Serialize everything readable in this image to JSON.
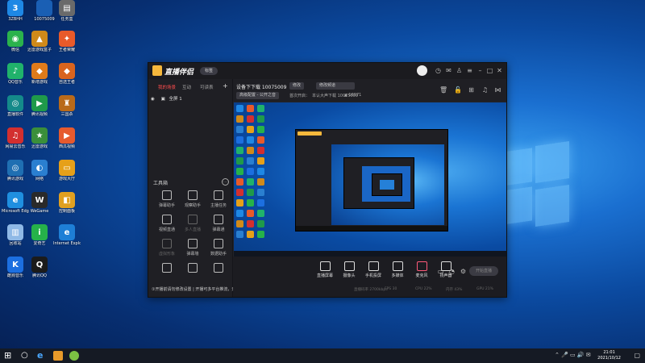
{
  "desktop": {
    "icons": [
      {
        "label": "3ZBHH",
        "color": "#1e88e5",
        "glyph": "3"
      },
      {
        "label": "10075009",
        "color": "#1a5fb4",
        "glyph": ""
      },
      {
        "label": "任务盒",
        "color": "#6a6a6a",
        "glyph": "▤"
      },
      {
        "label": "微信",
        "color": "#2bb24c",
        "glyph": "◉"
      },
      {
        "label": "迅雷游戏盒子",
        "color": "#d08a1a",
        "glyph": "▲"
      },
      {
        "label": "王者荣耀",
        "color": "#e85a2a",
        "glyph": "✦"
      },
      {
        "label": "QQ音乐",
        "color": "#20b26b",
        "glyph": "♪"
      },
      {
        "label": "新增游戏",
        "color": "#e07b1a",
        "glyph": "◆"
      },
      {
        "label": "自选王者",
        "color": "#d9641e",
        "glyph": "◆"
      },
      {
        "label": "直播软件",
        "color": "#148a8a",
        "glyph": "◎"
      },
      {
        "label": "腾讯视频",
        "color": "#1f9a4a",
        "glyph": "▶"
      },
      {
        "label": "三国杀",
        "color": "#b96a1a",
        "glyph": "♜"
      },
      {
        "label": "网易云音乐",
        "color": "#d32f2f",
        "glyph": "♫"
      },
      {
        "label": "迅雷游戏",
        "color": "#3a8f3a",
        "glyph": "★"
      },
      {
        "label": "西瓜视频",
        "color": "#e65a2e",
        "glyph": "▶"
      },
      {
        "label": "腾讯游戏",
        "color": "#1f6fb2",
        "glyph": "◎"
      },
      {
        "label": "网络",
        "color": "#2a7fd0",
        "glyph": "◐"
      },
      {
        "label": "游戏大厅",
        "color": "#e6a019",
        "glyph": "▭"
      },
      {
        "label": "Microsoft Edge",
        "color": "#1f8fe0",
        "glyph": "e"
      },
      {
        "label": "WeGame",
        "color": "#2a2a2a",
        "glyph": "W"
      },
      {
        "label": "控制面板",
        "color": "#e0a020",
        "glyph": "◧"
      },
      {
        "label": "回收站",
        "color": "#8fb9e6",
        "glyph": "▥"
      },
      {
        "label": "爱奇艺",
        "color": "#26b24a",
        "glyph": "i"
      },
      {
        "label": "Internet Explorer",
        "color": "#1e7fd6",
        "glyph": "e"
      },
      {
        "label": "酷狗音乐",
        "color": "#1c6fe0",
        "glyph": "K"
      },
      {
        "label": "腾讯QQ",
        "color": "#1b1b1b",
        "glyph": "Q"
      }
    ]
  },
  "window": {
    "app_title": "直播伴侣",
    "version_pill": "标签",
    "titlebar_icons": [
      "avatar",
      "clock-icon",
      "mail-icon",
      "shirt-icon",
      "menu-icon",
      "minimize-icon",
      "maximize-icon",
      "close-icon"
    ],
    "left_tabs": [
      "我的场景",
      "互动",
      "可读表"
    ],
    "scene_label": "全屏 1",
    "tools_title": "工具箱",
    "tools": [
      {
        "label": "弹幕助手",
        "dim": false
      },
      {
        "label": "观察助手",
        "dim": false
      },
      {
        "label": "主播任务",
        "dim": false
      },
      {
        "label": "视频直通",
        "dim": false
      },
      {
        "label": "多人直播",
        "dim": true
      },
      {
        "label": "弹幕通",
        "dim": false
      },
      {
        "label": "虚拟形象",
        "dim": true
      },
      {
        "label": "弹幕墙",
        "dim": false
      },
      {
        "label": "数据助手",
        "dim": false
      },
      {
        "label": "",
        "dim": false
      },
      {
        "label": "",
        "dim": false
      },
      {
        "label": "",
        "dim": false
      }
    ],
    "notice": "①开播前请勿修改设置 | 开播可多平台推流，开播后请勿关闭"
  },
  "room": {
    "title": "设备下下载 10075009",
    "chip1": "修改",
    "chip2": "修改频道",
    "tags": [
      "高级配置 - 公开之音",
      "首次开启："
    ],
    "sub": [
      "本认大声下载 10075009",
      "▲ 16071"
    ]
  },
  "bottom": {
    "items": [
      "直播屏幕",
      "摄像头",
      "手机投屏",
      "多媒体",
      "麦克风",
      "扬声器"
    ],
    "live_button": "开始直播",
    "stats": [
      "直播码率 2700kbps",
      "FPS 30",
      "CPU 22%",
      "内存 43%",
      "GPU 21%"
    ]
  },
  "taskbar": {
    "time": "21:01",
    "date": "2021/10/12"
  }
}
